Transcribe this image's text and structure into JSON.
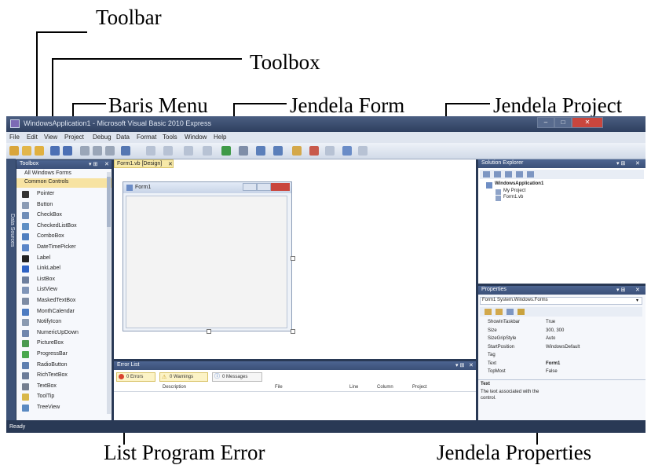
{
  "callouts": {
    "toolbar": "Toolbar",
    "toolbox": "Toolbox",
    "baris_menu": "Baris Menu",
    "jendela_form": "Jendela Form",
    "jendela_project": "Jendela Project",
    "list_error": "List Program Error",
    "jendela_properties": "Jendela Properties"
  },
  "ide": {
    "title": "WindowsApplication1 - Microsoft Visual Basic 2010 Express",
    "menu": [
      "File",
      "Edit",
      "View",
      "Project",
      "Debug",
      "Data",
      "Format",
      "Tools",
      "Window",
      "Help"
    ],
    "side_tab": "Data Sources",
    "toolbox": {
      "title": "Toolbox",
      "sections": [
        "All Windows Forms",
        "Common Controls"
      ],
      "items": [
        {
          "label": "Pointer",
          "icon": "pointer-icon",
          "color": "#333333"
        },
        {
          "label": "Button",
          "icon": "button-icon",
          "color": "#8a9bb5"
        },
        {
          "label": "CheckBox",
          "icon": "checkbox-icon",
          "color": "#6f8db8"
        },
        {
          "label": "CheckedListBox",
          "icon": "checkedlistbox-icon",
          "color": "#5f8fc4"
        },
        {
          "label": "ComboBox",
          "icon": "combobox-icon",
          "color": "#4f7fc0"
        },
        {
          "label": "DateTimePicker",
          "icon": "datetimepicker-icon",
          "color": "#5a86c8"
        },
        {
          "label": "Label",
          "icon": "label-icon",
          "color": "#222222"
        },
        {
          "label": "LinkLabel",
          "icon": "linklabel-icon",
          "color": "#2f63c4"
        },
        {
          "label": "ListBox",
          "icon": "listbox-icon",
          "color": "#6d7f9e"
        },
        {
          "label": "ListView",
          "icon": "listview-icon",
          "color": "#7f95b8"
        },
        {
          "label": "MaskedTextBox",
          "icon": "maskedtextbox-icon",
          "color": "#7d8ca4"
        },
        {
          "label": "MonthCalendar",
          "icon": "monthcalendar-icon",
          "color": "#4d7cc2"
        },
        {
          "label": "NotifyIcon",
          "icon": "notifyicon-icon",
          "color": "#8a9ab0"
        },
        {
          "label": "NumericUpDown",
          "icon": "numericupdown-icon",
          "color": "#6f86ad"
        },
        {
          "label": "PictureBox",
          "icon": "picturebox-icon",
          "color": "#4a9a50"
        },
        {
          "label": "ProgressBar",
          "icon": "progressbar-icon",
          "color": "#49a84e"
        },
        {
          "label": "RadioButton",
          "icon": "radiobutton-icon",
          "color": "#5e7fb0"
        },
        {
          "label": "RichTextBox",
          "icon": "richtextbox-icon",
          "color": "#6b7c99"
        },
        {
          "label": "TextBox",
          "icon": "textbox-icon",
          "color": "#757f90"
        },
        {
          "label": "ToolTip",
          "icon": "tooltip-icon",
          "color": "#d9b84a"
        },
        {
          "label": "TreeView",
          "icon": "treeview-icon",
          "color": "#5a8ac2"
        }
      ]
    },
    "doc_tab": "Form1.vb [Design]",
    "form_title": "Form1",
    "error_list": {
      "title": "Error List",
      "buttons": [
        "0 Errors",
        "0 Warnings",
        "0 Messages"
      ],
      "columns": [
        "Description",
        "File",
        "Line",
        "Column",
        "Project"
      ]
    },
    "solution": {
      "title": "Solution Explorer",
      "project": "WindowsApplication1",
      "items": [
        "My Project",
        "Form1.vb"
      ]
    },
    "properties": {
      "title": "Properties",
      "object": "Form1  System.Windows.Forms",
      "rows": [
        {
          "k": "ShowInTaskbar",
          "v": "True"
        },
        {
          "k": "Size",
          "v": "300, 300"
        },
        {
          "k": "SizeGripStyle",
          "v": "Auto"
        },
        {
          "k": "StartPosition",
          "v": "WindowsDefault"
        },
        {
          "k": "Tag",
          "v": ""
        },
        {
          "k": "Text",
          "v": "Form1"
        },
        {
          "k": "TopMost",
          "v": "False"
        }
      ],
      "desc_title": "Text",
      "desc_text": "The text associated with the control."
    },
    "status": "Ready"
  },
  "colors": {
    "ide_frame": "#293955",
    "panel_header": "#4d6591",
    "form_close": "#c9463d",
    "doc_tab": "#f7e9a8"
  }
}
